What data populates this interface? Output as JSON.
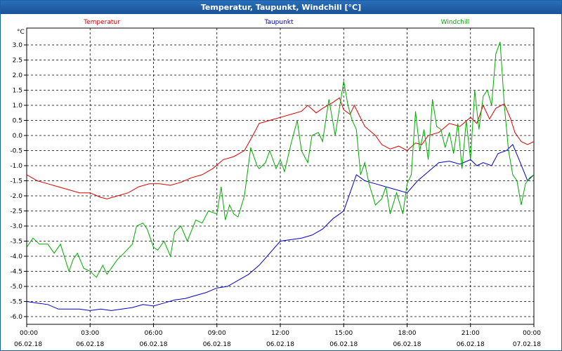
{
  "window": {
    "title": "Temperatur, Taupunkt, Windchill [°C]"
  },
  "chart_data": {
    "type": "line",
    "title": "Temperatur, Taupunkt, Windchill [°C]",
    "ylabel": "°C",
    "ylim": [
      -6.0,
      3.5
    ],
    "yticks": [
      "3.0",
      "2.5",
      "2.0",
      "1.5",
      "1.0",
      "0.5",
      "0.0",
      "-0.5",
      "-1.0",
      "-1.5",
      "-2.0",
      "-2.5",
      "-3.0",
      "-3.5",
      "-4.0",
      "-4.5",
      "-5.0",
      "-5.5",
      "-6.0"
    ],
    "xlim": [
      0,
      24
    ],
    "xticks": [
      {
        "time": "00:00",
        "date": "06.02.18"
      },
      {
        "time": "03:00",
        "date": "06.02.18"
      },
      {
        "time": "06:00",
        "date": "06.02.18"
      },
      {
        "time": "09:00",
        "date": "06.02.18"
      },
      {
        "time": "12:00",
        "date": "06.02.18"
      },
      {
        "time": "15:00",
        "date": "06.02.18"
      },
      {
        "time": "18:00",
        "date": "06.02.18"
      },
      {
        "time": "21:00",
        "date": "06.02.18"
      },
      {
        "time": "00:00",
        "date": "07.02.18"
      }
    ],
    "grid": true,
    "legend_position": "top",
    "series": [
      {
        "name": "Temperatur",
        "color": "#dd0000",
        "x": [
          0,
          0.5,
          1,
          1.5,
          2,
          2.5,
          3,
          3.5,
          3.8,
          4.3,
          4.8,
          5.3,
          5.8,
          6.3,
          6.8,
          7.3,
          7.8,
          8.3,
          8.8,
          9.3,
          9.8,
          10.3,
          10.7,
          11,
          11.5,
          12,
          12.5,
          13,
          13.3,
          13.7,
          14,
          14.5,
          14.8,
          15,
          15.3,
          15.5,
          16,
          16.5,
          16.8,
          17.2,
          17.6,
          18,
          18.4,
          18.7,
          19,
          19.5,
          20,
          20.5,
          21,
          21.3,
          21.6,
          21.9,
          22.2,
          22.6,
          22.9,
          23.1,
          23.4,
          23.7,
          24
        ],
        "values": [
          -1.3,
          -1.5,
          -1.6,
          -1.7,
          -1.8,
          -1.9,
          -1.9,
          -2.05,
          -2.1,
          -2.0,
          -1.9,
          -1.7,
          -1.6,
          -1.6,
          -1.65,
          -1.55,
          -1.4,
          -1.3,
          -1.1,
          -0.8,
          -0.7,
          -0.5,
          0.0,
          0.4,
          0.5,
          0.6,
          0.7,
          0.8,
          1.0,
          0.75,
          0.9,
          1.1,
          1.25,
          0.85,
          0.7,
          1.0,
          0.3,
          0.0,
          -0.3,
          -0.45,
          -0.35,
          -0.5,
          -0.25,
          -0.3,
          0.0,
          0.1,
          0.4,
          0.3,
          0.6,
          0.4,
          1.0,
          0.55,
          0.9,
          1.05,
          0.55,
          0.1,
          -0.2,
          -0.3,
          -0.2
        ]
      },
      {
        "name": "Taupunkt",
        "color": "#0000cc",
        "x": [
          0,
          0.5,
          1,
          1.5,
          2,
          2.5,
          3,
          3.5,
          4,
          4.5,
          5,
          5.5,
          6,
          6.5,
          7,
          7.5,
          8,
          8.5,
          9,
          9.5,
          10,
          10.5,
          11,
          11.5,
          12,
          12.5,
          13,
          13.5,
          14,
          14.5,
          15,
          15.3,
          15.6,
          16,
          16.5,
          17,
          17.5,
          18,
          18.5,
          19,
          19.5,
          20,
          20.5,
          21,
          21.3,
          21.6,
          22,
          22.3,
          22.7,
          23,
          23.3,
          23.7,
          24
        ],
        "values": [
          -5.5,
          -5.55,
          -5.6,
          -5.75,
          -5.75,
          -5.75,
          -5.8,
          -5.75,
          -5.8,
          -5.75,
          -5.7,
          -5.6,
          -5.65,
          -5.55,
          -5.45,
          -5.4,
          -5.3,
          -5.2,
          -5.05,
          -5.0,
          -4.8,
          -4.6,
          -4.3,
          -3.9,
          -3.5,
          -3.45,
          -3.4,
          -3.3,
          -3.1,
          -2.75,
          -2.5,
          -1.9,
          -1.3,
          -1.5,
          -1.6,
          -1.7,
          -1.8,
          -1.9,
          -1.5,
          -1.2,
          -0.9,
          -0.85,
          -0.95,
          -0.8,
          -1.0,
          -0.9,
          -1.0,
          -0.6,
          -0.5,
          -0.3,
          -0.8,
          -1.5,
          -1.3
        ]
      },
      {
        "name": "Windchill",
        "color": "#00aa00",
        "x": [
          0,
          0.3,
          0.6,
          1,
          1.3,
          1.6,
          2,
          2.2,
          2.4,
          2.7,
          3,
          3.3,
          3.6,
          3.8,
          4,
          4.3,
          4.6,
          5,
          5.2,
          5.5,
          5.7,
          6,
          6.2,
          6.5,
          6.8,
          7,
          7.3,
          7.6,
          8,
          8.3,
          8.6,
          9,
          9.2,
          9.4,
          9.6,
          9.8,
          10,
          10.3,
          10.6,
          10.9,
          11,
          11.3,
          11.5,
          11.8,
          12,
          12.2,
          12.5,
          12.8,
          13,
          13.3,
          13.5,
          13.8,
          14,
          14.3,
          14.6,
          14.8,
          15,
          15.2,
          15.4,
          15.6,
          15.8,
          16,
          16.2,
          16.5,
          16.8,
          17,
          17.2,
          17.5,
          17.8,
          18,
          18.2,
          18.4,
          18.6,
          18.8,
          19,
          19.2,
          19.4,
          19.6,
          19.8,
          20,
          20.2,
          20.4,
          20.6,
          20.8,
          21,
          21.2,
          21.4,
          21.6,
          21.8,
          22,
          22.2,
          22.4,
          22.6,
          22.8,
          23,
          23.2,
          23.4,
          23.6,
          23.8,
          24
        ],
        "values": [
          -3.7,
          -3.4,
          -3.6,
          -3.6,
          -3.9,
          -3.6,
          -4.5,
          -4.1,
          -3.9,
          -4.4,
          -4.5,
          -4.7,
          -4.3,
          -4.6,
          -4.4,
          -4.1,
          -3.9,
          -3.6,
          -3.0,
          -2.9,
          -3.1,
          -3.7,
          -3.8,
          -3.5,
          -4.0,
          -3.2,
          -3.0,
          -3.5,
          -2.8,
          -2.9,
          -2.5,
          -2.6,
          -1.7,
          -2.8,
          -2.3,
          -2.6,
          -2.7,
          -2.0,
          -0.4,
          -1.0,
          -1.1,
          -0.9,
          -0.5,
          -1.1,
          -0.8,
          -1.2,
          -0.3,
          0.5,
          -0.5,
          -0.9,
          0.0,
          0.1,
          -0.2,
          1.2,
          0.0,
          0.9,
          1.8,
          1.0,
          0.5,
          0.2,
          -1.3,
          -0.9,
          -1.6,
          -2.3,
          -2.1,
          -1.7,
          -2.6,
          -1.9,
          -2.6,
          -1.6,
          -1.3,
          0.8,
          -0.5,
          0.2,
          -0.8,
          1.2,
          0.3,
          0.2,
          -0.4,
          0.1,
          -0.6,
          0.4,
          -1.1,
          0.5,
          -0.8,
          1.5,
          0.2,
          1.3,
          1.5,
          1.0,
          2.7,
          3.1,
          1.0,
          -0.5,
          -1.3,
          -1.5,
          -2.3,
          -1.6,
          -1.4,
          -1.3
        ]
      }
    ]
  }
}
